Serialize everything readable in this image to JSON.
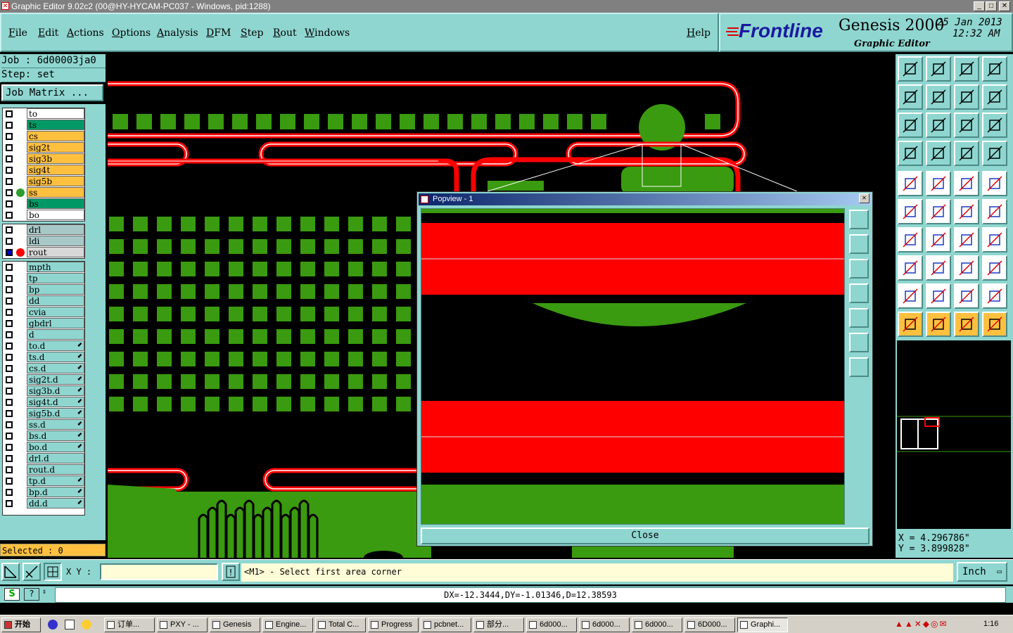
{
  "window": {
    "title": "Graphic Editor 9.02c2 (00@HY-HYCAM-PC037 - Windows, pid:1288)"
  },
  "menu": {
    "items": [
      "File",
      "Edit",
      "Actions",
      "Options",
      "Analysis",
      "DFM",
      "Step",
      "Rout",
      "Windows"
    ],
    "help": "Help"
  },
  "brand": {
    "logo": "Frontline",
    "product": "Genesis 2000",
    "date": "25 Jan 2013",
    "time": "12:32 AM",
    "subtitle": "Graphic Editor"
  },
  "job": {
    "job_label": "Job : 6d00003ja0",
    "step_label": "Step: set",
    "matrix_button": "Job Matrix ..."
  },
  "layers": {
    "group1": [
      {
        "name": "to",
        "color": "#ffffff",
        "dot": ""
      },
      {
        "name": "ts",
        "color": "#009966",
        "dot": ""
      },
      {
        "name": "cs",
        "color": "#ffc040",
        "dot": ""
      },
      {
        "name": "sig2t",
        "color": "#ffc040",
        "dot": ""
      },
      {
        "name": "sig3b",
        "color": "#ffc040",
        "dot": ""
      },
      {
        "name": "sig4t",
        "color": "#ffc040",
        "dot": ""
      },
      {
        "name": "sig5b",
        "color": "#ffc040",
        "dot": ""
      },
      {
        "name": "ss",
        "color": "#ffc040",
        "dot": "#2e9e2e"
      },
      {
        "name": "bs",
        "color": "#009966",
        "dot": ""
      },
      {
        "name": "bo",
        "color": "#ffffff",
        "dot": ""
      }
    ],
    "group2": [
      {
        "name": "drl",
        "color": "#a8c8c8",
        "dot": ""
      },
      {
        "name": "ldi",
        "color": "#a8c8c8",
        "dot": ""
      },
      {
        "name": "rout",
        "color": "#d8d8d8",
        "dot": "#ff0000",
        "active": true
      }
    ],
    "group3": [
      {
        "name": "mpth",
        "mk": ""
      },
      {
        "name": "tp",
        "mk": ""
      },
      {
        "name": "bp",
        "mk": ""
      },
      {
        "name": "dd",
        "mk": ""
      },
      {
        "name": "cvia",
        "mk": ""
      },
      {
        "name": "gbdrl",
        "mk": ""
      },
      {
        "name": "d",
        "mk": ""
      },
      {
        "name": "to.d",
        "mk": "⬋"
      },
      {
        "name": "ts.d",
        "mk": "⬋"
      },
      {
        "name": "cs.d",
        "mk": "⬋"
      },
      {
        "name": "sig2t.d",
        "mk": "⬋"
      },
      {
        "name": "sig3b.d",
        "mk": "⬋"
      },
      {
        "name": "sig4t.d",
        "mk": "⬋"
      },
      {
        "name": "sig5b.d",
        "mk": "⬋"
      },
      {
        "name": "ss.d",
        "mk": "⬋"
      },
      {
        "name": "bs.d",
        "mk": "⬋"
      },
      {
        "name": "bo.d",
        "mk": "⬋"
      },
      {
        "name": "drl.d",
        "mk": ""
      },
      {
        "name": "rout.d",
        "mk": ""
      },
      {
        "name": "tp.d",
        "mk": "⬋"
      },
      {
        "name": "bp.d",
        "mk": "⬋"
      },
      {
        "name": "dd.d",
        "mk": "⬋"
      }
    ]
  },
  "selected": "Selected : 0",
  "popview": {
    "title": "Popview - 1",
    "close_label": "Close"
  },
  "coords": {
    "x": "X = 4.296786\"",
    "y": "Y = 3.899828\""
  },
  "status": {
    "xy_label": "X Y :",
    "xy_value": "",
    "prompt": "<M1> - Select first area corner",
    "units": "Inch",
    "dx": "DX=-12.3444,DY=-1.01346,D=12.38593"
  },
  "taskbar": {
    "start": "开始",
    "tasks": [
      "订单...",
      "PXY - ...",
      "Genesis",
      "Engine...",
      "Total C...",
      "Progress",
      "pcbnet...",
      "部分...",
      "6d000...",
      "6d000...",
      "6d000...",
      "6D000...",
      "Graphi..."
    ],
    "clock": "1:16"
  },
  "colors": {
    "panel": "#8fd6d0",
    "board_green": "#3a9a10",
    "rout_red": "#ff0000",
    "selected_bg": "#ffc040"
  }
}
